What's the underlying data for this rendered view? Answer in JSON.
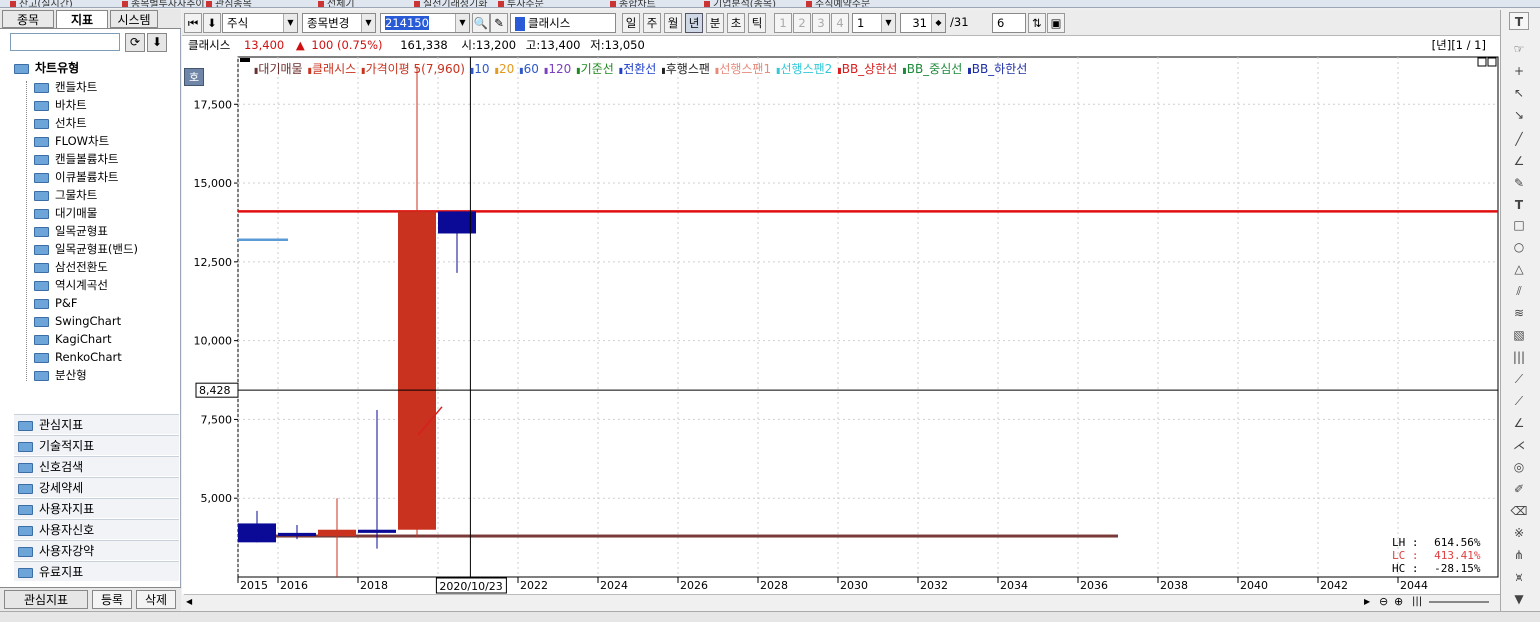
{
  "window_tabs": [
    "잔고(실시간)",
    "종목별투자자추이",
    "관심종목",
    "선체기",
    "실전기래정기화",
    "투자주문",
    "종합차트",
    "기업분석(종목)",
    "주식예약주문"
  ],
  "left_panel": {
    "tabs": [
      "종목",
      "지표",
      "시스템"
    ],
    "tree_header": "차트유형",
    "tree_items": [
      "캔들차트",
      "바차트",
      "선차트",
      "FLOW차트",
      "캔들볼륨차트",
      "이큐볼륨차트",
      "그물차트",
      "대기매물",
      "일목균형표",
      "일목균형표(밴드)",
      "삼선전환도",
      "역시계곡선",
      "P&F",
      "SwingChart",
      "KagiChart",
      "RenkoChart",
      "분산형"
    ],
    "groups": [
      "관심지표",
      "기술적지표",
      "신호검색",
      "강세약세",
      "사용자지표",
      "사용자신호",
      "사용자강약",
      "유료지표"
    ],
    "bottom_buttons": [
      "관심지표",
      "등록",
      "삭제"
    ]
  },
  "toolbar": {
    "market": "주식",
    "mode": "종목변경",
    "code": "214150",
    "name": "클래시스",
    "periods": [
      "일",
      "주",
      "월",
      "년",
      "분",
      "초",
      "틱"
    ],
    "selected_period": "년",
    "counts": [
      "1",
      "2",
      "3",
      "4"
    ],
    "count_value": "1",
    "range_value": "31",
    "range_total": "/31",
    "extra_value": "6"
  },
  "info": {
    "name": "클래시스",
    "price": "13,400",
    "change_symbol": "▲",
    "change": "100 (0.75%)",
    "volume": "161,338",
    "open": "시:13,200",
    "high": "고:13,400",
    "low": "저:13,050",
    "page": "[년][1 / 1]"
  },
  "chart": {
    "side_button": "호",
    "legend": [
      {
        "text": "대기매물",
        "color": "#6b2f2f"
      },
      {
        "text": "클래시스",
        "color": "#c8321e"
      },
      {
        "text": "가격이평 5(7,960)",
        "color": "#c8321e"
      },
      {
        "text": "10",
        "color": "#2e59c9"
      },
      {
        "text": "20",
        "color": "#e39a1e"
      },
      {
        "text": "60",
        "color": "#2e59c9"
      },
      {
        "text": "120",
        "color": "#7c3fbf"
      },
      {
        "text": "기준선",
        "color": "#1e8a1e"
      },
      {
        "text": "전환선",
        "color": "#1e3fc9"
      },
      {
        "text": "후행스팬",
        "color": "#222222"
      },
      {
        "text": "선행스팬1",
        "color": "#e68a7a"
      },
      {
        "text": "선행스팬2",
        "color": "#32c8d8"
      },
      {
        "text": "BB_상한선",
        "color": "#d81e1e"
      },
      {
        "text": "BB_중심선",
        "color": "#1e8a3a"
      },
      {
        "text": "BB_하한선",
        "color": "#1e2ea8"
      }
    ],
    "crosshair_price_label": "8,428",
    "crosshair_date_label": "2020/10/23",
    "stats": [
      {
        "label": "LH :",
        "value": "614.56%",
        "color": "#000000"
      },
      {
        "label": "LC :",
        "value": "413.41%",
        "color": "#e04040"
      },
      {
        "label": "HC :",
        "value": "-28.15%",
        "color": "#000000"
      }
    ]
  },
  "chart_data": {
    "type": "candlestick",
    "y_ticks": [
      "17,500",
      "15,000",
      "12,500",
      "10,000",
      "7,500",
      "5,000"
    ],
    "x_ticks": [
      "2015",
      "2016",
      "2018",
      "2020",
      "2022",
      "2024",
      "2026",
      "2028",
      "2030",
      "2032",
      "2034",
      "2036",
      "2038",
      "2040",
      "2042",
      "2044"
    ],
    "ylim": [
      2500,
      19000
    ],
    "xlim": [
      2015,
      2046.5
    ],
    "candles": [
      {
        "year": 2015,
        "open": 3600,
        "close": 4200,
        "high": 4600,
        "low": 3600,
        "color": "#0a0a96"
      },
      {
        "year": 2016,
        "open": 3800,
        "close": 3900,
        "high": 4150,
        "low": 3700,
        "color": "#0a0a96"
      },
      {
        "year": 2017,
        "open": 4000,
        "close": 3800,
        "high": 5000,
        "low": 2500,
        "color": "#c8321e"
      },
      {
        "year": 2018,
        "open": 3900,
        "close": 4000,
        "high": 7800,
        "low": 3400,
        "color": "#0a0a96"
      },
      {
        "year": 2019,
        "open": 4000,
        "close": 14100,
        "high": 18700,
        "low": 3750,
        "color": "#c8321e"
      },
      {
        "year": 2020,
        "open": 14100,
        "close": 13400,
        "high": 14100,
        "low": 12150,
        "color": "#0a0a96"
      }
    ],
    "horizontal_line": {
      "value": 14100,
      "color": "#e01010"
    },
    "crosshair": {
      "x": 2020.81,
      "y": 8428
    },
    "short_line": {
      "value": 13200,
      "from": 2015,
      "to": 2016.25,
      "color": "#5b9bd5"
    },
    "ma_segment": {
      "from": [
        2019.5,
        7000
      ],
      "to": [
        2020.1,
        7900
      ],
      "color": "#d81e1e"
    },
    "base_band": {
      "from": 2015,
      "to": 2037,
      "y": 3800,
      "color": "#7a3a3a"
    }
  }
}
